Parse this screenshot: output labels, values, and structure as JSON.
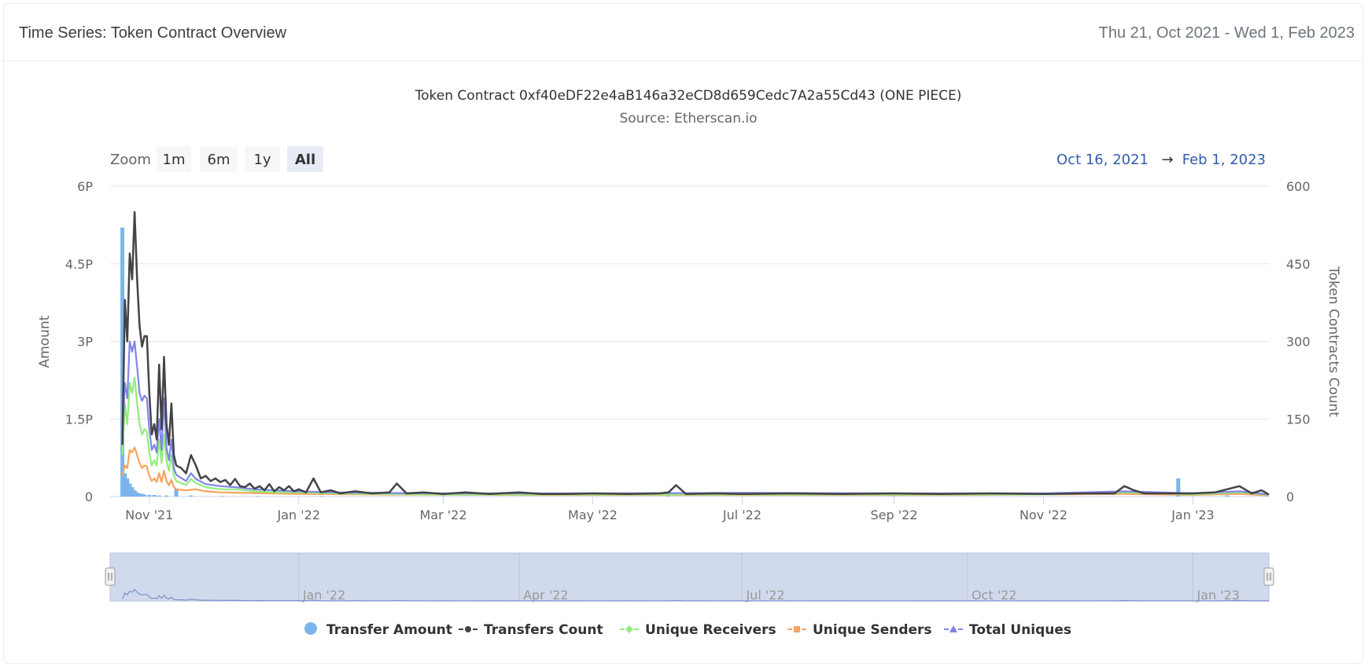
{
  "header": {
    "title": "Time Series: Token Contract Overview",
    "date_range": "Thu 21, Oct 2021 - Wed 1, Feb 2023"
  },
  "toolbar": {
    "zoom_label": "Zoom",
    "zoom_buttons": [
      "1m",
      "6m",
      "1y",
      "All"
    ],
    "active_zoom": "All",
    "range_from": "Oct 16, 2021",
    "range_arrow": "→",
    "range_to": "Feb 1, 2023"
  },
  "colors": {
    "transfer_amount": "#7cb5ec",
    "transfers_count": "#434348",
    "unique_receivers": "#90ed7d",
    "unique_senders": "#f7a35c",
    "total_uniques": "#8085e9",
    "navigator_fill": "#ccd6eb",
    "range_text": "#335cad"
  },
  "chart_data": {
    "type": "line",
    "title": "Token Contract 0xf40eDF22e4aB146a32eCD8d659Cedc7A2a55Cd43 (ONE PIECE)",
    "subtitle": "Source: Etherscan.io",
    "xlabel": "",
    "y_left_label": "Amount",
    "y_right_label": "Token Contracts Count",
    "x_range": [
      "2021-10-16",
      "2023-02-01"
    ],
    "y_left_ticks": [
      "0",
      "1.5P",
      "3P",
      "4.5P",
      "6P"
    ],
    "y_left_range": [
      0,
      6
    ],
    "y_left_unit": "P",
    "y_right_ticks": [
      "0",
      "150",
      "300",
      "450",
      "600"
    ],
    "y_right_range": [
      0,
      600
    ],
    "x_ticks": [
      {
        "date": "2021-11-01",
        "label": "Nov '21"
      },
      {
        "date": "2022-01-01",
        "label": "Jan '22"
      },
      {
        "date": "2022-03-01",
        "label": "Mar '22"
      },
      {
        "date": "2022-05-01",
        "label": "May '22"
      },
      {
        "date": "2022-07-01",
        "label": "Jul '22"
      },
      {
        "date": "2022-09-01",
        "label": "Sep '22"
      },
      {
        "date": "2022-11-01",
        "label": "Nov '22"
      },
      {
        "date": "2023-01-01",
        "label": "Jan '23"
      }
    ],
    "navigator_ticks": [
      {
        "date": "2022-01-01",
        "label": "Jan '22"
      },
      {
        "date": "2022-04-01",
        "label": "Apr '22"
      },
      {
        "date": "2022-07-01",
        "label": "Jul '22"
      },
      {
        "date": "2022-10-01",
        "label": "Oct '22"
      },
      {
        "date": "2023-01-01",
        "label": "Jan '23"
      }
    ],
    "grid": true,
    "legend_position": "bottom",
    "series": [
      {
        "name": "Transfer Amount",
        "type": "column",
        "axis": "left",
        "points": [
          [
            "2021-10-21",
            5.2
          ],
          [
            "2021-10-22",
            0.45
          ],
          [
            "2021-10-23",
            0.35
          ],
          [
            "2021-10-24",
            0.25
          ],
          [
            "2021-10-25",
            0.18
          ],
          [
            "2021-10-26",
            0.12
          ],
          [
            "2021-10-27",
            0.08
          ],
          [
            "2021-10-28",
            0.06
          ],
          [
            "2021-10-29",
            0.05
          ],
          [
            "2021-10-30",
            0.04
          ],
          [
            "2021-11-01",
            0.03
          ],
          [
            "2021-11-03",
            0.03
          ],
          [
            "2021-11-05",
            0.02
          ],
          [
            "2021-11-08",
            0.02
          ],
          [
            "2021-11-12",
            0.15
          ],
          [
            "2021-11-18",
            0.02
          ],
          [
            "2021-12-01",
            0.01
          ],
          [
            "2021-12-15",
            0.01
          ],
          [
            "2022-01-10",
            0.01
          ],
          [
            "2022-03-01",
            0.01
          ],
          [
            "2022-06-01",
            0.01
          ],
          [
            "2022-09-01",
            0.01
          ],
          [
            "2022-12-26",
            0.35
          ],
          [
            "2023-01-15",
            0.02
          ]
        ]
      },
      {
        "name": "Transfers Count",
        "type": "line",
        "axis": "right",
        "points": [
          [
            "2021-10-21",
            100
          ],
          [
            "2021-10-22",
            380
          ],
          [
            "2021-10-23",
            300
          ],
          [
            "2021-10-24",
            470
          ],
          [
            "2021-10-25",
            420
          ],
          [
            "2021-10-26",
            550
          ],
          [
            "2021-10-27",
            420
          ],
          [
            "2021-10-28",
            330
          ],
          [
            "2021-10-29",
            290
          ],
          [
            "2021-10-30",
            310
          ],
          [
            "2021-10-31",
            310
          ],
          [
            "2021-11-01",
            200
          ],
          [
            "2021-11-02",
            120
          ],
          [
            "2021-11-03",
            140
          ],
          [
            "2021-11-04",
            110
          ],
          [
            "2021-11-05",
            255
          ],
          [
            "2021-11-06",
            130
          ],
          [
            "2021-11-07",
            270
          ],
          [
            "2021-11-08",
            140
          ],
          [
            "2021-11-09",
            100
          ],
          [
            "2021-11-10",
            180
          ],
          [
            "2021-11-11",
            80
          ],
          [
            "2021-11-12",
            60
          ],
          [
            "2021-11-14",
            55
          ],
          [
            "2021-11-16",
            45
          ],
          [
            "2021-11-18",
            80
          ],
          [
            "2021-11-20",
            60
          ],
          [
            "2021-11-22",
            35
          ],
          [
            "2021-11-24",
            40
          ],
          [
            "2021-11-26",
            30
          ],
          [
            "2021-11-28",
            35
          ],
          [
            "2021-11-30",
            28
          ],
          [
            "2021-12-02",
            32
          ],
          [
            "2021-12-04",
            22
          ],
          [
            "2021-12-06",
            34
          ],
          [
            "2021-12-08",
            20
          ],
          [
            "2021-12-10",
            18
          ],
          [
            "2021-12-12",
            25
          ],
          [
            "2021-12-14",
            15
          ],
          [
            "2021-12-16",
            20
          ],
          [
            "2021-12-18",
            12
          ],
          [
            "2021-12-20",
            24
          ],
          [
            "2021-12-22",
            10
          ],
          [
            "2021-12-24",
            18
          ],
          [
            "2021-12-26",
            12
          ],
          [
            "2021-12-28",
            20
          ],
          [
            "2021-12-30",
            10
          ],
          [
            "2022-01-01",
            14
          ],
          [
            "2022-01-04",
            8
          ],
          [
            "2022-01-07",
            35
          ],
          [
            "2022-01-10",
            8
          ],
          [
            "2022-01-14",
            12
          ],
          [
            "2022-01-18",
            6
          ],
          [
            "2022-01-24",
            10
          ],
          [
            "2022-01-31",
            6
          ],
          [
            "2022-02-07",
            8
          ],
          [
            "2022-02-10",
            25
          ],
          [
            "2022-02-14",
            6
          ],
          [
            "2022-02-21",
            8
          ],
          [
            "2022-03-01",
            5
          ],
          [
            "2022-03-10",
            8
          ],
          [
            "2022-03-20",
            5
          ],
          [
            "2022-04-01",
            8
          ],
          [
            "2022-04-10",
            5
          ],
          [
            "2022-04-20",
            5
          ],
          [
            "2022-05-01",
            6
          ],
          [
            "2022-05-15",
            5
          ],
          [
            "2022-05-28",
            6
          ],
          [
            "2022-06-01",
            8
          ],
          [
            "2022-06-04",
            22
          ],
          [
            "2022-06-08",
            5
          ],
          [
            "2022-06-20",
            6
          ],
          [
            "2022-07-01",
            5
          ],
          [
            "2022-07-20",
            6
          ],
          [
            "2022-08-10",
            5
          ],
          [
            "2022-09-01",
            6
          ],
          [
            "2022-09-20",
            5
          ],
          [
            "2022-10-10",
            6
          ],
          [
            "2022-11-01",
            5
          ],
          [
            "2022-11-20",
            6
          ],
          [
            "2022-11-30",
            6
          ],
          [
            "2022-12-04",
            20
          ],
          [
            "2022-12-08",
            12
          ],
          [
            "2022-12-12",
            6
          ],
          [
            "2022-12-20",
            6
          ],
          [
            "2023-01-01",
            6
          ],
          [
            "2023-01-10",
            8
          ],
          [
            "2023-01-20",
            20
          ],
          [
            "2023-01-25",
            6
          ],
          [
            "2023-01-29",
            12
          ],
          [
            "2023-02-01",
            4
          ]
        ]
      },
      {
        "name": "Unique Receivers",
        "type": "line",
        "axis": "right",
        "points": [
          [
            "2021-10-21",
            80
          ],
          [
            "2021-10-22",
            180
          ],
          [
            "2021-10-23",
            140
          ],
          [
            "2021-10-24",
            220
          ],
          [
            "2021-10-25",
            200
          ],
          [
            "2021-10-26",
            230
          ],
          [
            "2021-10-27",
            180
          ],
          [
            "2021-10-28",
            140
          ],
          [
            "2021-10-29",
            120
          ],
          [
            "2021-10-30",
            130
          ],
          [
            "2021-10-31",
            125
          ],
          [
            "2021-11-01",
            85
          ],
          [
            "2021-11-02",
            60
          ],
          [
            "2021-11-03",
            70
          ],
          [
            "2021-11-04",
            60
          ],
          [
            "2021-11-05",
            110
          ],
          [
            "2021-11-06",
            65
          ],
          [
            "2021-11-07",
            120
          ],
          [
            "2021-11-08",
            70
          ],
          [
            "2021-11-09",
            50
          ],
          [
            "2021-11-10",
            80
          ],
          [
            "2021-11-11",
            40
          ],
          [
            "2021-11-12",
            30
          ],
          [
            "2021-11-14",
            26
          ],
          [
            "2021-11-16",
            22
          ],
          [
            "2021-11-18",
            34
          ],
          [
            "2021-11-20",
            26
          ],
          [
            "2021-11-24",
            18
          ],
          [
            "2021-11-30",
            14
          ],
          [
            "2021-12-06",
            14
          ],
          [
            "2021-12-14",
            10
          ],
          [
            "2021-12-22",
            8
          ],
          [
            "2022-01-01",
            8
          ],
          [
            "2022-01-15",
            6
          ],
          [
            "2022-02-01",
            5
          ],
          [
            "2022-03-01",
            4
          ],
          [
            "2022-05-01",
            4
          ],
          [
            "2022-07-01",
            4
          ],
          [
            "2022-09-01",
            4
          ],
          [
            "2022-11-01",
            4
          ],
          [
            "2022-12-04",
            8
          ],
          [
            "2023-01-01",
            4
          ],
          [
            "2023-01-20",
            8
          ],
          [
            "2023-02-01",
            3
          ]
        ]
      },
      {
        "name": "Unique Senders",
        "type": "line",
        "axis": "right",
        "points": [
          [
            "2021-10-21",
            40
          ],
          [
            "2021-10-22",
            60
          ],
          [
            "2021-10-23",
            55
          ],
          [
            "2021-10-24",
            90
          ],
          [
            "2021-10-25",
            85
          ],
          [
            "2021-10-26",
            95
          ],
          [
            "2021-10-27",
            80
          ],
          [
            "2021-10-28",
            65
          ],
          [
            "2021-10-29",
            55
          ],
          [
            "2021-10-30",
            60
          ],
          [
            "2021-10-31",
            58
          ],
          [
            "2021-11-01",
            40
          ],
          [
            "2021-11-02",
            30
          ],
          [
            "2021-11-03",
            35
          ],
          [
            "2021-11-04",
            28
          ],
          [
            "2021-11-05",
            45
          ],
          [
            "2021-11-06",
            28
          ],
          [
            "2021-11-07",
            50
          ],
          [
            "2021-11-08",
            30
          ],
          [
            "2021-11-09",
            22
          ],
          [
            "2021-11-10",
            32
          ],
          [
            "2021-11-11",
            18
          ],
          [
            "2021-11-12",
            14
          ],
          [
            "2021-11-16",
            12
          ],
          [
            "2021-11-20",
            14
          ],
          [
            "2021-11-24",
            10
          ],
          [
            "2021-11-30",
            8
          ],
          [
            "2021-12-10",
            7
          ],
          [
            "2021-12-20",
            6
          ],
          [
            "2022-01-01",
            5
          ],
          [
            "2022-02-01",
            4
          ],
          [
            "2022-04-01",
            3
          ],
          [
            "2022-07-01",
            3
          ],
          [
            "2022-10-01",
            3
          ],
          [
            "2022-12-04",
            5
          ],
          [
            "2023-01-01",
            3
          ],
          [
            "2023-01-20",
            5
          ],
          [
            "2023-02-01",
            2
          ]
        ]
      },
      {
        "name": "Total Uniques",
        "type": "line",
        "axis": "right",
        "points": [
          [
            "2021-10-21",
            110
          ],
          [
            "2021-10-22",
            220
          ],
          [
            "2021-10-23",
            190
          ],
          [
            "2021-10-24",
            300
          ],
          [
            "2021-10-25",
            280
          ],
          [
            "2021-10-26",
            300
          ],
          [
            "2021-10-27",
            250
          ],
          [
            "2021-10-28",
            200
          ],
          [
            "2021-10-29",
            185
          ],
          [
            "2021-10-30",
            195
          ],
          [
            "2021-10-31",
            190
          ],
          [
            "2021-11-01",
            130
          ],
          [
            "2021-11-02",
            90
          ],
          [
            "2021-11-03",
            100
          ],
          [
            "2021-11-04",
            85
          ],
          [
            "2021-11-05",
            150
          ],
          [
            "2021-11-06",
            90
          ],
          [
            "2021-11-07",
            190
          ],
          [
            "2021-11-08",
            95
          ],
          [
            "2021-11-09",
            70
          ],
          [
            "2021-11-10",
            110
          ],
          [
            "2021-11-11",
            55
          ],
          [
            "2021-11-12",
            42
          ],
          [
            "2021-11-14",
            36
          ],
          [
            "2021-11-16",
            30
          ],
          [
            "2021-11-18",
            45
          ],
          [
            "2021-11-20",
            34
          ],
          [
            "2021-11-24",
            24
          ],
          [
            "2021-11-30",
            20
          ],
          [
            "2021-12-06",
            18
          ],
          [
            "2021-12-14",
            14
          ],
          [
            "2021-12-22",
            12
          ],
          [
            "2022-01-01",
            10
          ],
          [
            "2022-01-15",
            8
          ],
          [
            "2022-02-01",
            7
          ],
          [
            "2022-03-01",
            6
          ],
          [
            "2022-05-01",
            6
          ],
          [
            "2022-07-01",
            7
          ],
          [
            "2022-09-01",
            6
          ],
          [
            "2022-11-01",
            6
          ],
          [
            "2022-12-04",
            10
          ],
          [
            "2023-01-01",
            6
          ],
          [
            "2023-01-20",
            10
          ],
          [
            "2023-02-01",
            4
          ]
        ]
      }
    ]
  }
}
